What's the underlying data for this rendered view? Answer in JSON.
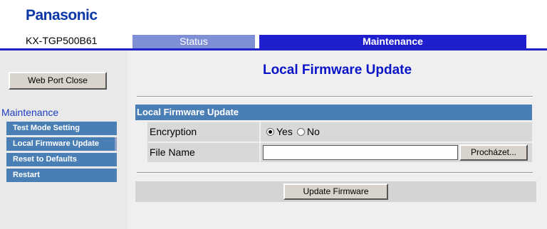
{
  "brand": {
    "logo_text": "Panasonic"
  },
  "header": {
    "model": "KX-TGP500B61",
    "tabs": [
      {
        "label": "Status",
        "active": false
      },
      {
        "label": "Maintenance",
        "active": true
      }
    ]
  },
  "sidebar": {
    "web_port_button": "Web Port Close",
    "section_title": "Maintenance",
    "items": [
      {
        "label": "Test Mode Setting"
      },
      {
        "label": "Local Firmware Update"
      },
      {
        "label": "Reset to Defaults"
      },
      {
        "label": "Restart"
      }
    ]
  },
  "main": {
    "title": "Local Firmware Update",
    "panel_title": "Local Firmware Update",
    "encryption": {
      "label": "Encryption",
      "options": [
        {
          "label": "Yes",
          "checked": true
        },
        {
          "label": "No",
          "checked": false
        }
      ]
    },
    "file_name": {
      "label": "File Name",
      "value": "",
      "browse_label": "Procházet..."
    },
    "submit_label": "Update Firmware"
  },
  "colors": {
    "logo": "#0b36a8",
    "tab_active": "#1f1fd0",
    "tab_inactive": "#7f8fd6",
    "accent_blue": "#4a7fb6",
    "title_blue": "#0a14c8"
  }
}
